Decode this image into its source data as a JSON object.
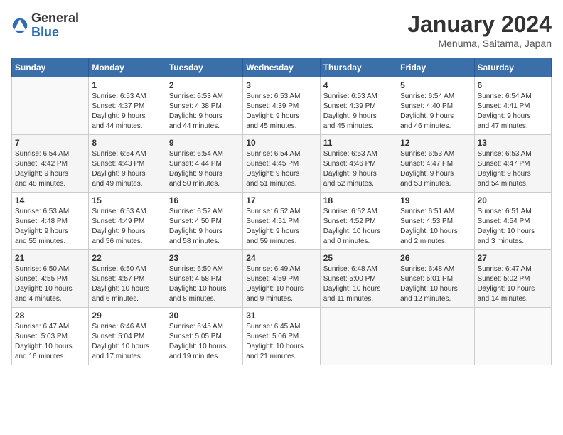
{
  "header": {
    "logo_general": "General",
    "logo_blue": "Blue",
    "month_title": "January 2024",
    "subtitle": "Menuma, Saitama, Japan"
  },
  "columns": [
    "Sunday",
    "Monday",
    "Tuesday",
    "Wednesday",
    "Thursday",
    "Friday",
    "Saturday"
  ],
  "weeks": [
    [
      {
        "day": "",
        "info": ""
      },
      {
        "day": "1",
        "info": "Sunrise: 6:53 AM\nSunset: 4:37 PM\nDaylight: 9 hours\nand 44 minutes."
      },
      {
        "day": "2",
        "info": "Sunrise: 6:53 AM\nSunset: 4:38 PM\nDaylight: 9 hours\nand 44 minutes."
      },
      {
        "day": "3",
        "info": "Sunrise: 6:53 AM\nSunset: 4:39 PM\nDaylight: 9 hours\nand 45 minutes."
      },
      {
        "day": "4",
        "info": "Sunrise: 6:53 AM\nSunset: 4:39 PM\nDaylight: 9 hours\nand 45 minutes."
      },
      {
        "day": "5",
        "info": "Sunrise: 6:54 AM\nSunset: 4:40 PM\nDaylight: 9 hours\nand 46 minutes."
      },
      {
        "day": "6",
        "info": "Sunrise: 6:54 AM\nSunset: 4:41 PM\nDaylight: 9 hours\nand 47 minutes."
      }
    ],
    [
      {
        "day": "7",
        "info": "Sunrise: 6:54 AM\nSunset: 4:42 PM\nDaylight: 9 hours\nand 48 minutes."
      },
      {
        "day": "8",
        "info": "Sunrise: 6:54 AM\nSunset: 4:43 PM\nDaylight: 9 hours\nand 49 minutes."
      },
      {
        "day": "9",
        "info": "Sunrise: 6:54 AM\nSunset: 4:44 PM\nDaylight: 9 hours\nand 50 minutes."
      },
      {
        "day": "10",
        "info": "Sunrise: 6:54 AM\nSunset: 4:45 PM\nDaylight: 9 hours\nand 51 minutes."
      },
      {
        "day": "11",
        "info": "Sunrise: 6:53 AM\nSunset: 4:46 PM\nDaylight: 9 hours\nand 52 minutes."
      },
      {
        "day": "12",
        "info": "Sunrise: 6:53 AM\nSunset: 4:47 PM\nDaylight: 9 hours\nand 53 minutes."
      },
      {
        "day": "13",
        "info": "Sunrise: 6:53 AM\nSunset: 4:47 PM\nDaylight: 9 hours\nand 54 minutes."
      }
    ],
    [
      {
        "day": "14",
        "info": "Sunrise: 6:53 AM\nSunset: 4:48 PM\nDaylight: 9 hours\nand 55 minutes."
      },
      {
        "day": "15",
        "info": "Sunrise: 6:53 AM\nSunset: 4:49 PM\nDaylight: 9 hours\nand 56 minutes."
      },
      {
        "day": "16",
        "info": "Sunrise: 6:52 AM\nSunset: 4:50 PM\nDaylight: 9 hours\nand 58 minutes."
      },
      {
        "day": "17",
        "info": "Sunrise: 6:52 AM\nSunset: 4:51 PM\nDaylight: 9 hours\nand 59 minutes."
      },
      {
        "day": "18",
        "info": "Sunrise: 6:52 AM\nSunset: 4:52 PM\nDaylight: 10 hours\nand 0 minutes."
      },
      {
        "day": "19",
        "info": "Sunrise: 6:51 AM\nSunset: 4:53 PM\nDaylight: 10 hours\nand 2 minutes."
      },
      {
        "day": "20",
        "info": "Sunrise: 6:51 AM\nSunset: 4:54 PM\nDaylight: 10 hours\nand 3 minutes."
      }
    ],
    [
      {
        "day": "21",
        "info": "Sunrise: 6:50 AM\nSunset: 4:55 PM\nDaylight: 10 hours\nand 4 minutes."
      },
      {
        "day": "22",
        "info": "Sunrise: 6:50 AM\nSunset: 4:57 PM\nDaylight: 10 hours\nand 6 minutes."
      },
      {
        "day": "23",
        "info": "Sunrise: 6:50 AM\nSunset: 4:58 PM\nDaylight: 10 hours\nand 8 minutes."
      },
      {
        "day": "24",
        "info": "Sunrise: 6:49 AM\nSunset: 4:59 PM\nDaylight: 10 hours\nand 9 minutes."
      },
      {
        "day": "25",
        "info": "Sunrise: 6:48 AM\nSunset: 5:00 PM\nDaylight: 10 hours\nand 11 minutes."
      },
      {
        "day": "26",
        "info": "Sunrise: 6:48 AM\nSunset: 5:01 PM\nDaylight: 10 hours\nand 12 minutes."
      },
      {
        "day": "27",
        "info": "Sunrise: 6:47 AM\nSunset: 5:02 PM\nDaylight: 10 hours\nand 14 minutes."
      }
    ],
    [
      {
        "day": "28",
        "info": "Sunrise: 6:47 AM\nSunset: 5:03 PM\nDaylight: 10 hours\nand 16 minutes."
      },
      {
        "day": "29",
        "info": "Sunrise: 6:46 AM\nSunset: 5:04 PM\nDaylight: 10 hours\nand 17 minutes."
      },
      {
        "day": "30",
        "info": "Sunrise: 6:45 AM\nSunset: 5:05 PM\nDaylight: 10 hours\nand 19 minutes."
      },
      {
        "day": "31",
        "info": "Sunrise: 6:45 AM\nSunset: 5:06 PM\nDaylight: 10 hours\nand 21 minutes."
      },
      {
        "day": "",
        "info": ""
      },
      {
        "day": "",
        "info": ""
      },
      {
        "day": "",
        "info": ""
      }
    ]
  ]
}
